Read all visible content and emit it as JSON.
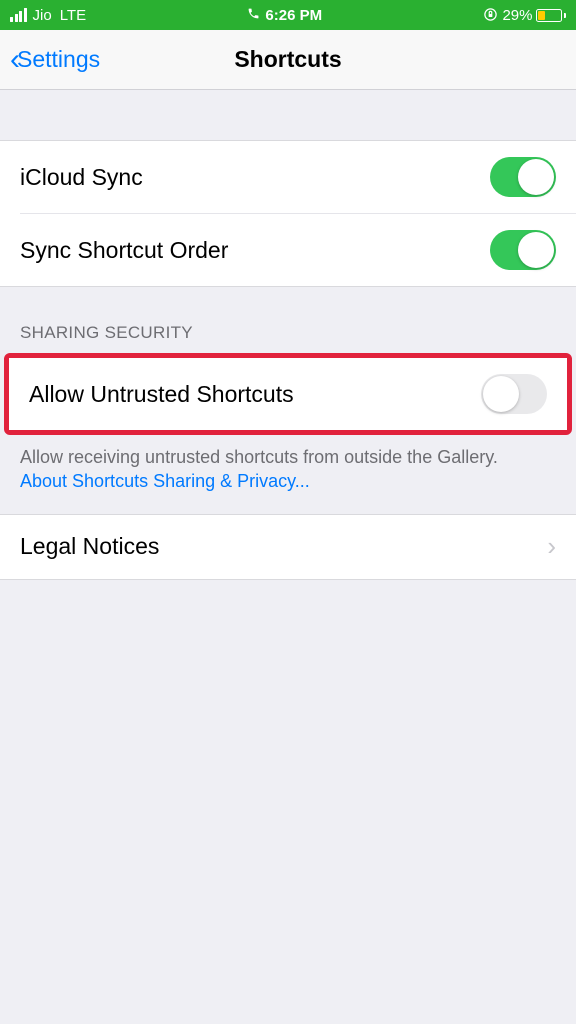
{
  "status": {
    "carrier": "Jio",
    "network": "LTE",
    "time": "6:26 PM",
    "battery_pct": "29%"
  },
  "nav": {
    "back_label": "Settings",
    "title": "Shortcuts"
  },
  "sync": {
    "icloud_label": "iCloud Sync",
    "order_label": "Sync Shortcut Order"
  },
  "security": {
    "header": "Sharing Security",
    "allow_untrusted_label": "Allow Untrusted Shortcuts",
    "footer_text": "Allow receiving untrusted shortcuts from outside the Gallery.",
    "footer_link": "About Shortcuts Sharing & Privacy..."
  },
  "legal": {
    "label": "Legal Notices"
  }
}
